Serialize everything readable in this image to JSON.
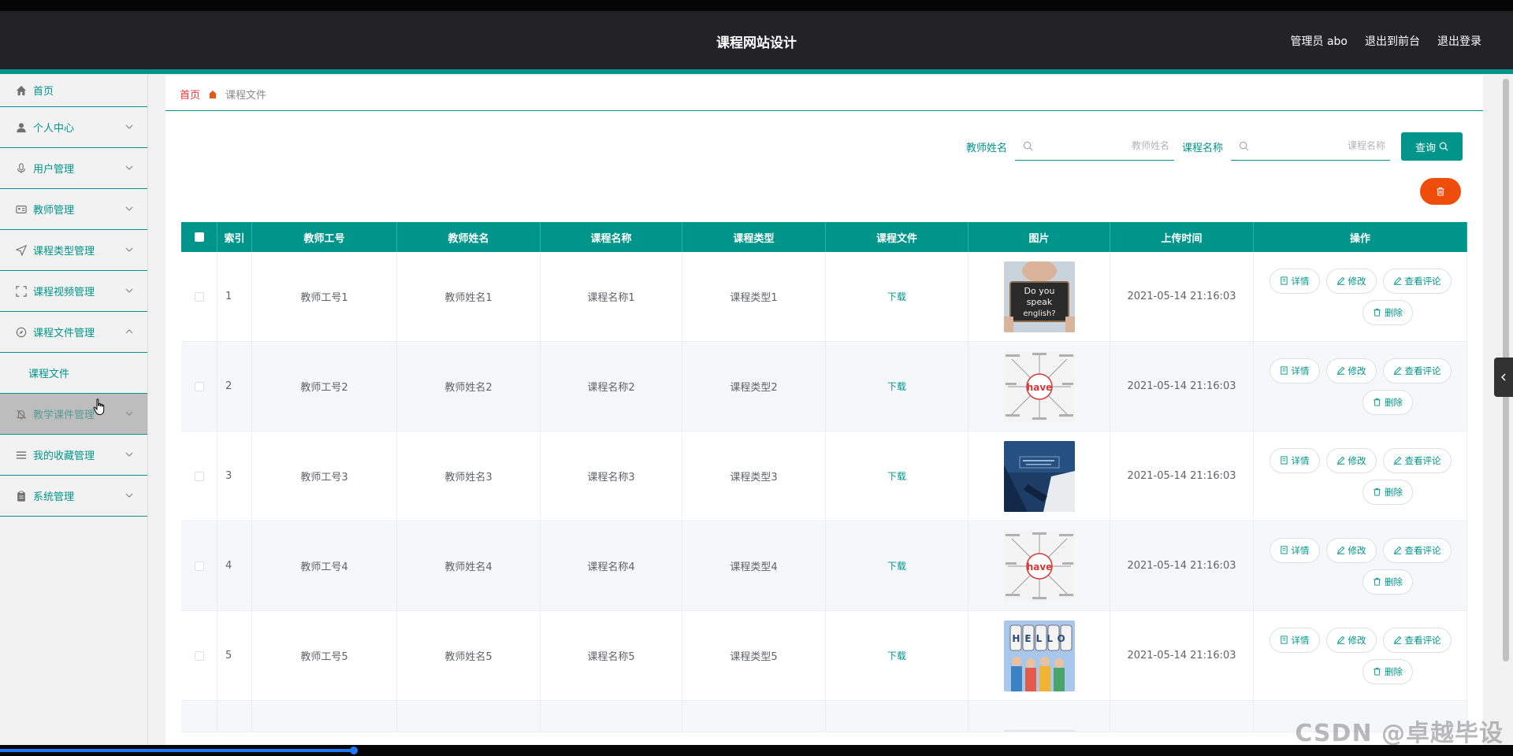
{
  "header": {
    "title": "课程网站设计",
    "admin": "管理员 abo",
    "to_front": "退出到前台",
    "logout": "退出登录"
  },
  "sidebar": {
    "items": [
      {
        "label": "首页",
        "icon": "home-icon"
      },
      {
        "label": "个人中心",
        "icon": "user-icon"
      },
      {
        "label": "用户管理",
        "icon": "mic-icon"
      },
      {
        "label": "教师管理",
        "icon": "id-card-icon"
      },
      {
        "label": "课程类型管理",
        "icon": "send-icon"
      },
      {
        "label": "课程视频管理",
        "icon": "fullscreen-icon"
      },
      {
        "label": "课程文件管理",
        "icon": "compass-icon"
      },
      {
        "label": "课程文件",
        "icon": ""
      },
      {
        "label": "教学课件管理",
        "icon": "bell-off-icon"
      },
      {
        "label": "我的收藏管理",
        "icon": "list-icon"
      },
      {
        "label": "系统管理",
        "icon": "clipboard-icon"
      }
    ]
  },
  "breadcrumb": {
    "home": "首页",
    "current": "课程文件"
  },
  "search": {
    "teacher_label": "教师姓名",
    "teacher_placeholder": "教师姓名",
    "course_label": "课程名称",
    "course_placeholder": "课程名称",
    "query_label": "查询"
  },
  "table": {
    "headers": {
      "index": "索引",
      "teacher_no": "教师工号",
      "teacher_name": "教师姓名",
      "course_name": "课程名称",
      "course_type": "课程类型",
      "course_file": "课程文件",
      "picture": "图片",
      "upload_time": "上传时间",
      "actions": "操作"
    },
    "rows": [
      {
        "index": "1",
        "teacher_no": "教师工号1",
        "teacher_name": "教师姓名1",
        "course_name": "课程名称1",
        "course_type": "课程类型1",
        "file_link": "下载",
        "upload_time": "2021-05-14 21:16:03"
      },
      {
        "index": "2",
        "teacher_no": "教师工号2",
        "teacher_name": "教师姓名2",
        "course_name": "课程名称2",
        "course_type": "课程类型2",
        "file_link": "下载",
        "upload_time": "2021-05-14 21:16:03"
      },
      {
        "index": "3",
        "teacher_no": "教师工号3",
        "teacher_name": "教师姓名3",
        "course_name": "课程名称3",
        "course_type": "课程类型3",
        "file_link": "下载",
        "upload_time": "2021-05-14 21:16:03"
      },
      {
        "index": "4",
        "teacher_no": "教师工号4",
        "teacher_name": "教师姓名4",
        "course_name": "课程名称4",
        "course_type": "课程类型4",
        "file_link": "下载",
        "upload_time": "2021-05-14 21:16:03"
      },
      {
        "index": "5",
        "teacher_no": "教师工号5",
        "teacher_name": "教师姓名5",
        "course_name": "课程名称5",
        "course_type": "课程类型5",
        "file_link": "下载",
        "upload_time": "2021-05-14 21:16:03"
      }
    ],
    "actions": {
      "detail": "详情",
      "edit": "修改",
      "comments": "查看评论",
      "delete": "删除"
    },
    "pictures": {
      "p1_line1": "Do you",
      "p1_line2": "speak",
      "p1_line3": "english?",
      "p2_word": "have",
      "p5_word": "HELLO"
    }
  },
  "watermark": "CSDN @卓越毕设",
  "colors": {
    "accent": "#00958a",
    "header_bg": "#232326",
    "danger": "#ee4d0b",
    "breadcrumb_home": "#e0373a"
  }
}
